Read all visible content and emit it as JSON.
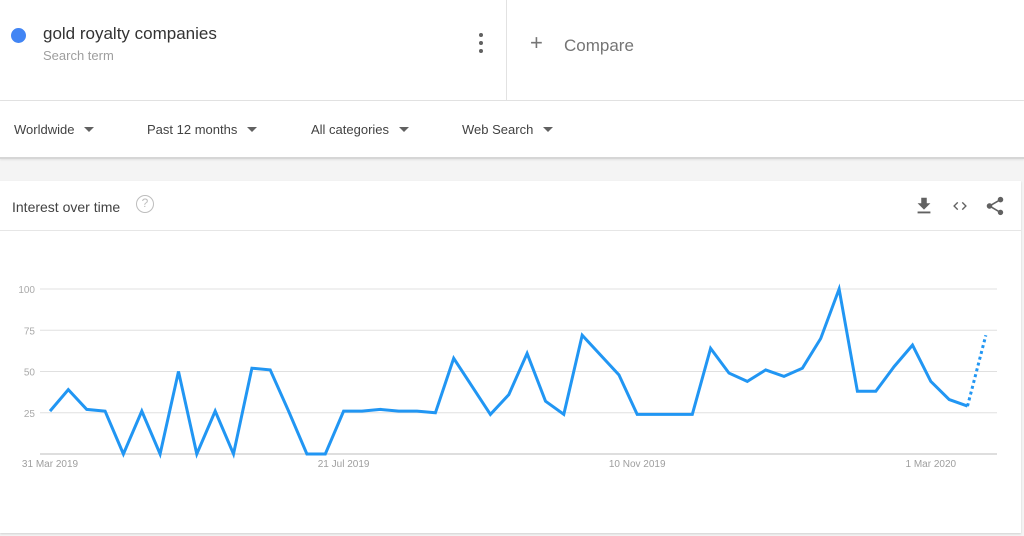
{
  "search_term": {
    "name": "gold royalty companies",
    "subtitle": "Search term",
    "color": "#4285f4",
    "more_icon": "more-vert-icon"
  },
  "compare": {
    "label": "Compare",
    "icon": "plus-icon"
  },
  "filters": [
    {
      "label": "Worldwide"
    },
    {
      "label": "Past 12 months"
    },
    {
      "label": "All categories"
    },
    {
      "label": "Web Search"
    }
  ],
  "card": {
    "title": "Interest over time",
    "help_glyph": "?",
    "actions": [
      "download-icon",
      "embed-code-icon",
      "share-icon"
    ]
  },
  "chart_data": {
    "type": "line",
    "title": "Interest over time",
    "series_color": "#2196f3",
    "ylim": [
      0,
      100
    ],
    "yticks": [
      25,
      50,
      75,
      100
    ],
    "xtick_labels": [
      "31 Mar 2019",
      "21 Jul 2019",
      "10 Nov 2019",
      "1 Mar 2020"
    ],
    "xtick_indices": [
      0,
      16,
      32,
      48
    ],
    "grid": true,
    "partial_last_point": true,
    "series": [
      {
        "name": "gold royalty companies",
        "values": [
          26,
          39,
          27,
          26,
          0,
          26,
          0,
          50,
          0,
          26,
          0,
          52,
          51,
          26,
          0,
          0,
          26,
          26,
          27,
          26,
          26,
          25,
          58,
          41,
          24,
          36,
          61,
          32,
          24,
          72,
          60,
          48,
          24,
          24,
          24,
          24,
          64,
          49,
          44,
          51,
          47,
          52,
          70,
          100,
          38,
          38,
          53,
          66,
          44,
          33,
          29,
          72
        ]
      }
    ]
  }
}
